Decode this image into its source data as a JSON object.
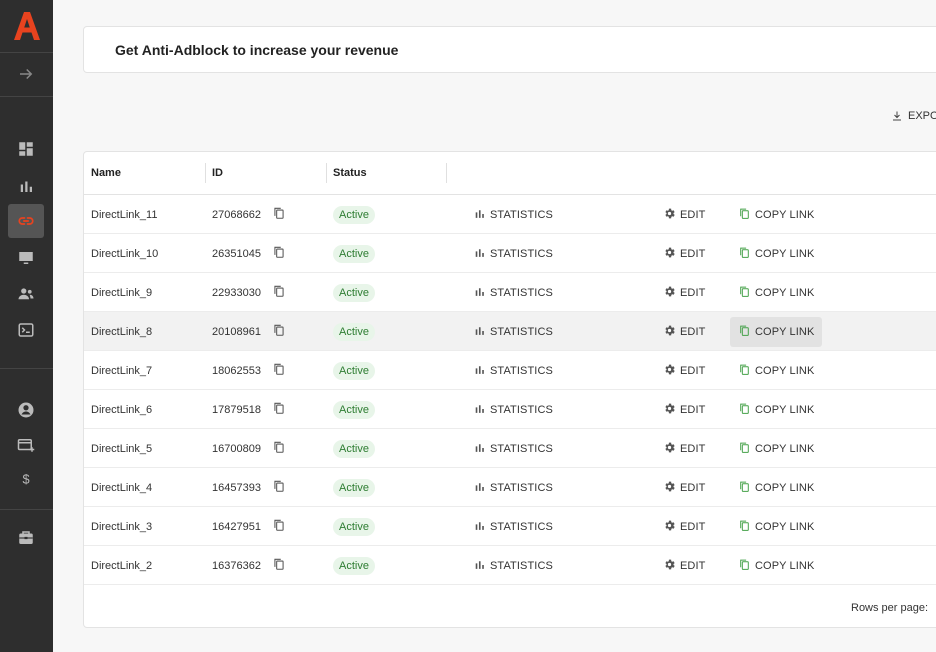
{
  "colors": {
    "sidebar_bg": "#2e2e2e",
    "brand": "#e8431f",
    "active_badge_bg": "#e8f5e9",
    "active_badge_text": "#2e7d32"
  },
  "sidebar": {
    "items": [
      {
        "name": "collapse-arrow-icon"
      },
      {
        "name": "dashboard-icon"
      },
      {
        "name": "bar-chart-icon"
      },
      {
        "name": "link-icon",
        "active": true
      },
      {
        "name": "monitor-icon"
      },
      {
        "name": "users-icon"
      },
      {
        "name": "terminal-icon"
      },
      {
        "name": "account-icon"
      },
      {
        "name": "add-card-icon"
      },
      {
        "name": "dollar-icon"
      },
      {
        "name": "toolbox-icon"
      }
    ]
  },
  "banner": {
    "text": "Get Anti-Adblock to increase your revenue"
  },
  "toolbar": {
    "export_label": "EXPORT"
  },
  "table": {
    "headers": {
      "name": "Name",
      "id": "ID",
      "status": "Status"
    },
    "actions": {
      "statistics": "STATISTICS",
      "edit": "EDIT",
      "copy_link": "COPY LINK"
    },
    "rows": [
      {
        "name": "DirectLink_11",
        "id": "27068662",
        "status": "Active"
      },
      {
        "name": "DirectLink_10",
        "id": "26351045",
        "status": "Active"
      },
      {
        "name": "DirectLink_9",
        "id": "22933030",
        "status": "Active"
      },
      {
        "name": "DirectLink_8",
        "id": "20108961",
        "status": "Active"
      },
      {
        "name": "DirectLink_7",
        "id": "18062553",
        "status": "Active"
      },
      {
        "name": "DirectLink_6",
        "id": "17879518",
        "status": "Active"
      },
      {
        "name": "DirectLink_5",
        "id": "16700809",
        "status": "Active"
      },
      {
        "name": "DirectLink_4",
        "id": "16457393",
        "status": "Active"
      },
      {
        "name": "DirectLink_3",
        "id": "16427951",
        "status": "Active"
      },
      {
        "name": "DirectLink_2",
        "id": "16376362",
        "status": "Active"
      }
    ],
    "footer": {
      "rows_per_page_label": "Rows per page:"
    }
  }
}
